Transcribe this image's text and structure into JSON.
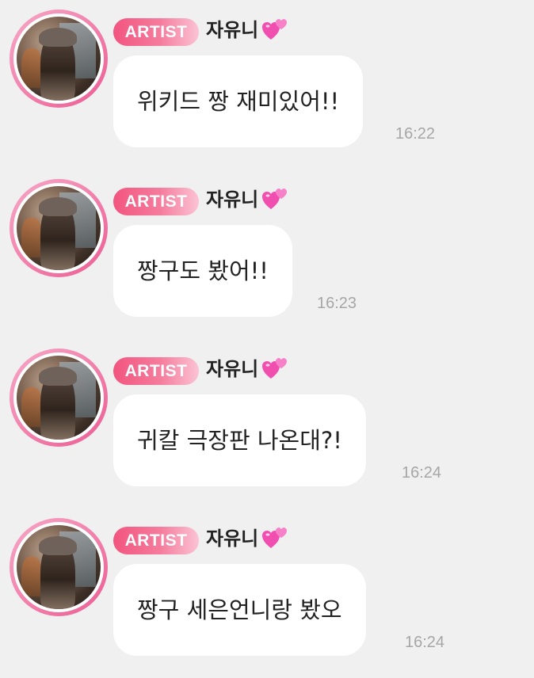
{
  "messages": [
    {
      "badge": "ARTIST",
      "sender": "자유니",
      "text": "위키드 짱 재미있어!!",
      "time": "16:22"
    },
    {
      "badge": "ARTIST",
      "sender": "자유니",
      "text": "짱구도 봤어!!",
      "time": "16:23"
    },
    {
      "badge": "ARTIST",
      "sender": "자유니",
      "text": "귀칼 극장판 나온대?!",
      "time": "16:24"
    },
    {
      "badge": "ARTIST",
      "sender": "자유니",
      "text": "짱구 세은언니랑 봤오",
      "time": "16:24"
    }
  ],
  "icons": {
    "sender_emoji": "two-hearts-icon"
  },
  "colors": {
    "badge": "#f2557f",
    "heart": "#f14fb0",
    "bubble": "#ffffff",
    "background": "#f1f0f1",
    "time": "#a6a6a6"
  }
}
